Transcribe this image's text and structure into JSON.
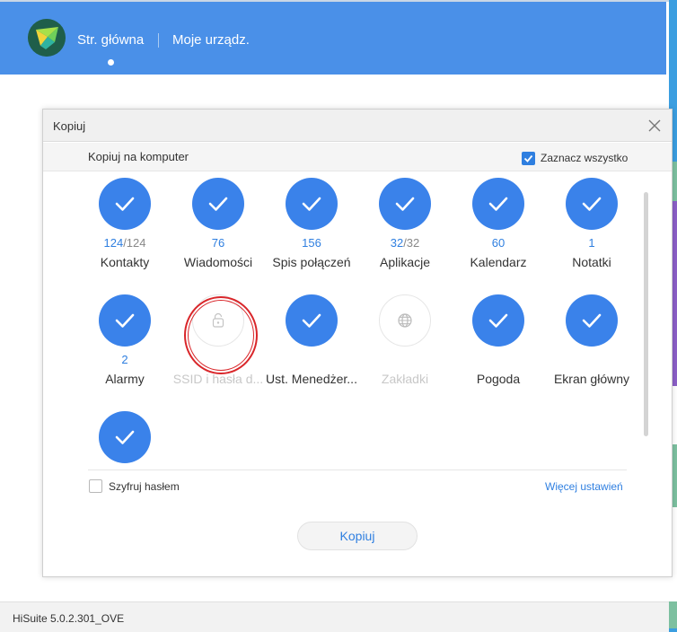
{
  "header": {
    "nav_home": "Str. główna",
    "nav_devices": "Moje urządz."
  },
  "dialog": {
    "title": "Kopiuj",
    "subtitle": "Kopiuj na komputer",
    "select_all_label": "Zaznacz wszystko",
    "select_all_checked": true,
    "items": [
      {
        "label": "Kontakty",
        "selected": "124",
        "total": "/124",
        "checked": true,
        "icon": "check-icon"
      },
      {
        "label": "Wiadomości",
        "selected": "76",
        "total": "",
        "checked": true,
        "icon": "check-icon"
      },
      {
        "label": "Spis połączeń",
        "selected": "156",
        "total": "",
        "checked": true,
        "icon": "check-icon"
      },
      {
        "label": "Aplikacje",
        "selected": "32",
        "total": "/32",
        "checked": true,
        "icon": "check-icon"
      },
      {
        "label": "Kalendarz",
        "selected": "60",
        "total": "",
        "checked": true,
        "icon": "check-icon"
      },
      {
        "label": "Notatki",
        "selected": "1",
        "total": "",
        "checked": true,
        "icon": "check-icon"
      },
      {
        "label": "Alarmy",
        "selected": "2",
        "total": "",
        "checked": true,
        "icon": "check-icon"
      },
      {
        "label": "SSID i hasła d...",
        "selected": "",
        "total": "",
        "checked": false,
        "icon": "lock-icon"
      },
      {
        "label": "Ust. Menedżer...",
        "selected": "",
        "total": "",
        "checked": true,
        "icon": "check-icon"
      },
      {
        "label": "Zakładki",
        "selected": "",
        "total": "",
        "checked": false,
        "icon": "globe-icon"
      },
      {
        "label": "Pogoda",
        "selected": "",
        "total": "",
        "checked": true,
        "icon": "check-icon"
      },
      {
        "label": "Ekran główny",
        "selected": "",
        "total": "",
        "checked": true,
        "icon": "check-icon"
      },
      {
        "label": "",
        "selected": "",
        "total": "",
        "checked": true,
        "icon": "check-icon"
      }
    ],
    "encrypt_label": "Szyfruj hasłem",
    "encrypt_checked": false,
    "more_settings_label": "Więcej ustawień",
    "copy_button_label": "Kopiuj"
  },
  "footer": {
    "version": "HiSuite 5.0.2.301_OVE"
  },
  "colors": {
    "header_blue": "#4a90e8",
    "accent_blue": "#3a82ea",
    "link_blue": "#2f7fe0",
    "annotation_red": "#d9262a"
  }
}
